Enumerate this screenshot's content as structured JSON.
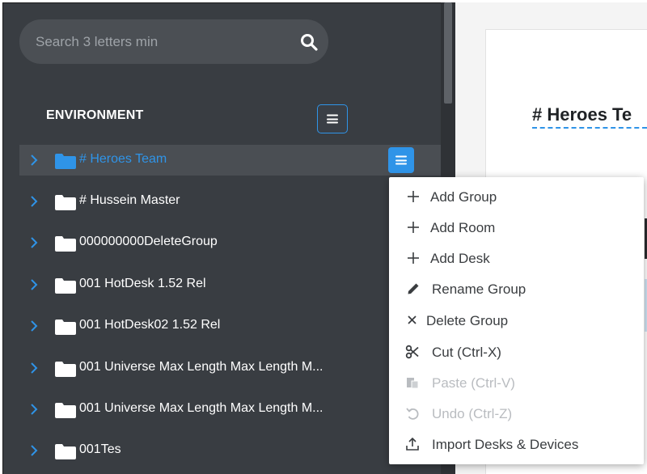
{
  "search": {
    "placeholder": "Search 3 letters min"
  },
  "sidebar": {
    "section_title": "ENVIRONMENT",
    "items": [
      {
        "label": "# Heroes Team",
        "selected": true
      },
      {
        "label": "# Hussein Master",
        "selected": false
      },
      {
        "label": "000000000DeleteGroup",
        "selected": false
      },
      {
        "label": "001 HotDesk 1.52 Rel",
        "selected": false
      },
      {
        "label": "001 HotDesk02 1.52 Rel",
        "selected": false
      },
      {
        "label": "001 Universe Max Length Max Length M...",
        "selected": false
      },
      {
        "label": "001 Universe Max Length Max Length M...",
        "selected": false
      },
      {
        "label": "001Tes",
        "selected": false
      }
    ]
  },
  "detail": {
    "title": "# Heroes Te"
  },
  "context_menu": {
    "items": [
      {
        "label": "Add Group",
        "icon": "plus-icon",
        "enabled": true
      },
      {
        "label": "Add Room",
        "icon": "plus-icon",
        "enabled": true
      },
      {
        "label": "Add Desk",
        "icon": "plus-icon",
        "enabled": true
      },
      {
        "label": "Rename Group",
        "icon": "pencil-icon",
        "enabled": true
      },
      {
        "label": "Delete Group",
        "icon": "x-icon",
        "enabled": true
      },
      {
        "label": "Cut (Ctrl-X)",
        "icon": "scissors-icon",
        "enabled": true
      },
      {
        "label": "Paste (Ctrl-V)",
        "icon": "paste-icon",
        "enabled": false
      },
      {
        "label": "Undo (Ctrl-Z)",
        "icon": "undo-icon",
        "enabled": false
      },
      {
        "label": "Import Desks & Devices",
        "icon": "upload-icon",
        "enabled": true
      }
    ]
  },
  "colors": {
    "sidebar_bg": "#393d42",
    "selected_row_bg": "#4a4e53",
    "accent_blue": "#2f94e8",
    "menu_text": "#3a3d40",
    "menu_disabled_text": "#b9bcc0"
  }
}
